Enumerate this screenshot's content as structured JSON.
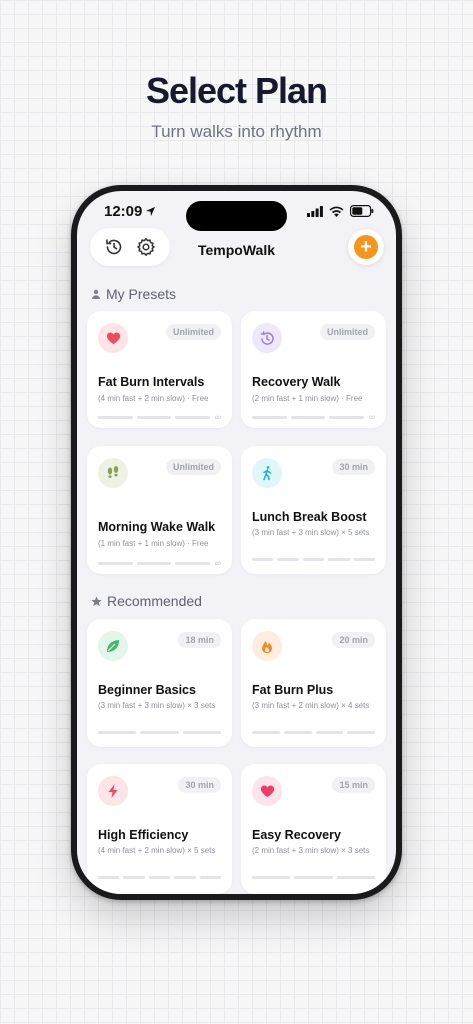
{
  "headline": "Select Plan",
  "subhead": "Turn walks into rhythm",
  "status": {
    "time": "12:09"
  },
  "app": {
    "title": "TempoWalk",
    "add_label": "+"
  },
  "sections": {
    "presets": "My Presets",
    "recommended": "Recommended"
  },
  "presets": [
    {
      "name": "Fat Burn Intervals",
      "desc": "(4 min fast + 2 min slow) · Free",
      "badge": "Unlimited",
      "icon": "heart-icon",
      "color": "#ef4a5e",
      "bg": "#fde4e7"
    },
    {
      "name": "Recovery Walk",
      "desc": "(2 min fast + 1 min slow) · Free",
      "badge": "Unlimited",
      "icon": "timer-icon",
      "color": "#9b7fd6",
      "bg": "#eee8f8"
    },
    {
      "name": "Morning Wake Walk",
      "desc": "(1 min fast + 1 min slow) · Free",
      "badge": "Unlimited",
      "icon": "footsteps-icon",
      "color": "#8aa05c",
      "bg": "#eef2e3"
    },
    {
      "name": "Lunch Break Boost",
      "desc": "(3 min fast + 3 min slow) × 5 sets",
      "badge": "30 min",
      "icon": "walker-icon",
      "color": "#1fb6c9",
      "bg": "#e0f6f8"
    }
  ],
  "recommended": [
    {
      "name": "Beginner Basics",
      "desc": "(3 min fast + 3 min slow) × 3 sets",
      "badge": "18 min",
      "icon": "leaf-icon",
      "color": "#3dbb6a",
      "bg": "#e2f6e9"
    },
    {
      "name": "Fat Burn Plus",
      "desc": "(3 min fast + 2 min slow) × 4 sets",
      "badge": "20 min",
      "icon": "flame-icon",
      "color": "#f28c2a",
      "bg": "#fdeedf"
    },
    {
      "name": "High Efficiency",
      "desc": "(4 min fast + 2 min slow) × 5 sets",
      "badge": "30 min",
      "icon": "bolt-icon",
      "color": "#ef4a5e",
      "bg": "#fde4e7"
    },
    {
      "name": "Easy Recovery",
      "desc": "(2 min fast + 3 min slow) × 3 sets",
      "badge": "15 min",
      "icon": "heart-icon",
      "color": "#ef3d6a",
      "bg": "#fde4ea"
    }
  ]
}
